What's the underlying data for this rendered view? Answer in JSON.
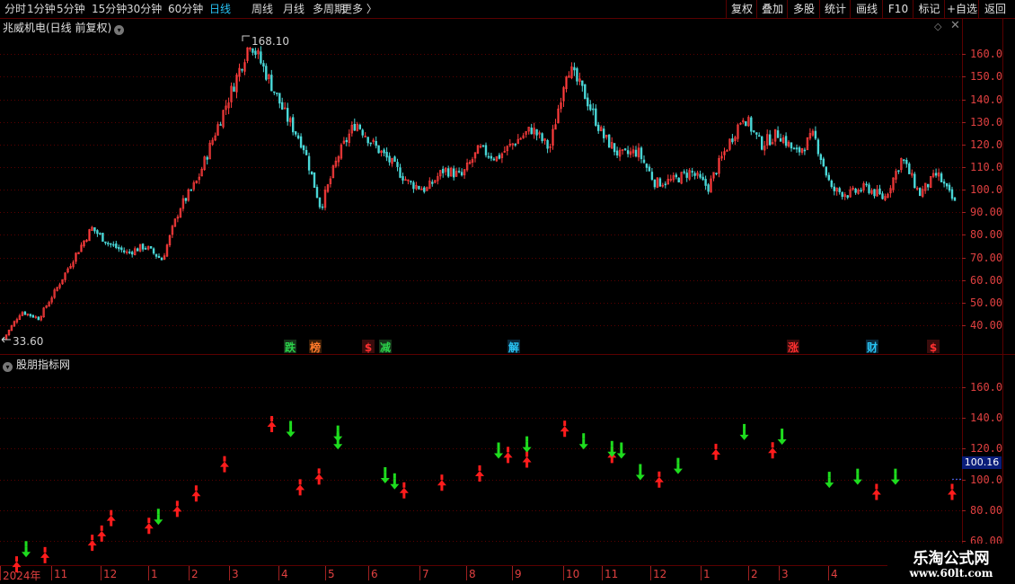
{
  "toolbar": {
    "periods": [
      {
        "label": "分时",
        "active": false
      },
      {
        "label": "1分钟",
        "active": false
      },
      {
        "label": "5分钟",
        "active": false
      },
      {
        "label": "15分钟",
        "active": false
      },
      {
        "label": "30分钟",
        "active": false
      },
      {
        "label": "60分钟",
        "active": false
      },
      {
        "label": "日线",
        "active": true
      },
      {
        "label": "周线",
        "active": false
      },
      {
        "label": "月线",
        "active": false
      },
      {
        "label": "多周期",
        "active": false
      },
      {
        "label": "更多 〉",
        "active": false
      }
    ],
    "buttons": [
      "复权",
      "叠加",
      "多股",
      "统计",
      "画线",
      "F10",
      "标记",
      "+自选",
      "返回"
    ]
  },
  "main_pane": {
    "title": "兆威机电(日线 前复权)",
    "max_label": "168.10",
    "min_label": "33.60",
    "y_ticks": [
      "160.0",
      "150.0",
      "140.0",
      "130.0",
      "120.0",
      "110.0",
      "100.0",
      "90.00",
      "80.00",
      "70.00",
      "60.00",
      "50.00",
      "40.00"
    ],
    "markers": [
      {
        "text": "跌",
        "color": "#2bd24a",
        "bg": "#16341a"
      },
      {
        "text": "榜",
        "color": "#ff7a2a",
        "bg": "#3a1e08"
      },
      {
        "text": "$",
        "color": "#ff3030",
        "bg": "#3a0c0c"
      },
      {
        "text": "减",
        "color": "#2bd24a",
        "bg": "#16341a"
      },
      {
        "text": "解",
        "color": "#28c4f4",
        "bg": "#0a2a3c"
      },
      {
        "text": "涨",
        "color": "#ff3030",
        "bg": "#3a0c0c"
      },
      {
        "text": "财",
        "color": "#28c4f4",
        "bg": "#0a2a3c"
      },
      {
        "text": "$",
        "color": "#ff3030",
        "bg": "#3a0c0c"
      }
    ]
  },
  "indicator_pane": {
    "title": "股朋指标网",
    "y_ticks": [
      "160.0",
      "140.0",
      "120.0",
      "100.0",
      "80.00",
      "60.00"
    ],
    "current_value": "100.16"
  },
  "x_axis": {
    "labels": [
      "2024年",
      "11",
      "12",
      "1",
      "2",
      "3",
      "4",
      "5",
      "6",
      "7",
      "8",
      "9",
      "10",
      "11",
      "12",
      "1",
      "2",
      "3",
      "4"
    ]
  },
  "watermark": {
    "line1": "乐淘公式网",
    "line2": "www.60lt.com"
  },
  "colors": {
    "up": "#ff3c3c",
    "down": "#4ad8d8",
    "grid": "#5a0000",
    "axis_text": "#e04040",
    "active": "#27c3f5",
    "buy_arrow": "#ff1c1c",
    "sell_arrow": "#1edc1e"
  },
  "chart_data": {
    "type": "candlestick",
    "title": "兆威机电(日线 前复权)",
    "period": "日线",
    "adjust": "前复权",
    "ylim": [
      33.6,
      168.1
    ],
    "max_marked": 168.1,
    "min_marked": 33.6,
    "y_ticks": [
      160,
      150,
      140,
      130,
      120,
      110,
      100,
      90,
      80,
      70,
      60,
      50,
      40
    ],
    "approx_close_path": [
      {
        "date": "2024-10",
        "close": 34
      },
      {
        "date": "2024-10",
        "close": 46
      },
      {
        "date": "2024-11",
        "close": 43
      },
      {
        "date": "2024-11",
        "close": 56
      },
      {
        "date": "2024-11",
        "close": 70
      },
      {
        "date": "2024-12",
        "close": 83
      },
      {
        "date": "2024-12",
        "close": 76
      },
      {
        "date": "2024-12",
        "close": 72
      },
      {
        "date": "2025-01",
        "close": 75
      },
      {
        "date": "2025-01",
        "close": 69
      },
      {
        "date": "2025-01",
        "close": 92
      },
      {
        "date": "2025-02",
        "close": 104
      },
      {
        "date": "2025-02",
        "close": 125
      },
      {
        "date": "2025-02",
        "close": 145
      },
      {
        "date": "2025-03",
        "close": 166
      },
      {
        "date": "2025-03",
        "close": 150
      },
      {
        "date": "2025-03",
        "close": 133
      },
      {
        "date": "2025-04",
        "close": 120
      },
      {
        "date": "2025-04",
        "close": 92
      },
      {
        "date": "2025-04",
        "close": 115
      },
      {
        "date": "2025-05",
        "close": 130
      },
      {
        "date": "2025-05",
        "close": 120
      },
      {
        "date": "2025-05",
        "close": 112
      },
      {
        "date": "2025-06",
        "close": 103
      },
      {
        "date": "2025-06",
        "close": 100
      },
      {
        "date": "2025-07",
        "close": 109
      },
      {
        "date": "2025-07",
        "close": 106
      },
      {
        "date": "2025-07",
        "close": 118
      },
      {
        "date": "2025-08",
        "close": 114
      },
      {
        "date": "2025-08",
        "close": 121
      },
      {
        "date": "2025-08",
        "close": 127
      },
      {
        "date": "2025-09",
        "close": 118
      },
      {
        "date": "2025-09",
        "close": 155
      },
      {
        "date": "2025-09",
        "close": 142
      },
      {
        "date": "2025-10",
        "close": 124
      },
      {
        "date": "2025-10",
        "close": 115
      },
      {
        "date": "2025-11",
        "close": 117
      },
      {
        "date": "2025-11",
        "close": 103
      },
      {
        "date": "2025-11",
        "close": 104
      },
      {
        "date": "2025-12",
        "close": 108
      },
      {
        "date": "2025-12",
        "close": 101
      },
      {
        "date": "2025-12",
        "close": 118
      },
      {
        "date": "2026-01",
        "close": 133
      },
      {
        "date": "2026-01",
        "close": 120
      },
      {
        "date": "2026-02",
        "close": 125
      },
      {
        "date": "2026-02",
        "close": 116
      },
      {
        "date": "2026-03",
        "close": 124
      },
      {
        "date": "2026-03",
        "close": 100
      },
      {
        "date": "2026-03",
        "close": 98
      },
      {
        "date": "2026-04",
        "close": 101
      },
      {
        "date": "2026-04",
        "close": 96
      },
      {
        "date": "2026-04",
        "close": 114
      },
      {
        "date": "2026-05",
        "close": 98
      },
      {
        "date": "2026-05",
        "close": 107
      },
      {
        "date": "2026-05",
        "close": 94
      }
    ],
    "indicator": {
      "name": "股朋指标网",
      "ylim": [
        45,
        175
      ],
      "y_ticks": [
        160,
        140,
        120,
        100,
        80,
        60
      ],
      "current": 100.16,
      "signals": [
        {
          "t": 0.01,
          "v": 42,
          "dir": "up"
        },
        {
          "t": 0.02,
          "v": 53,
          "dir": "down"
        },
        {
          "t": 0.04,
          "v": 48,
          "dir": "up"
        },
        {
          "t": 0.09,
          "v": 56,
          "dir": "up"
        },
        {
          "t": 0.1,
          "v": 62,
          "dir": "up"
        },
        {
          "t": 0.11,
          "v": 72,
          "dir": "up"
        },
        {
          "t": 0.15,
          "v": 67,
          "dir": "up"
        },
        {
          "t": 0.16,
          "v": 74,
          "dir": "down"
        },
        {
          "t": 0.18,
          "v": 78,
          "dir": "up"
        },
        {
          "t": 0.2,
          "v": 88,
          "dir": "up"
        },
        {
          "t": 0.23,
          "v": 107,
          "dir": "up"
        },
        {
          "t": 0.28,
          "v": 133,
          "dir": "up"
        },
        {
          "t": 0.3,
          "v": 131,
          "dir": "down"
        },
        {
          "t": 0.31,
          "v": 92,
          "dir": "up"
        },
        {
          "t": 0.33,
          "v": 99,
          "dir": "up"
        },
        {
          "t": 0.35,
          "v": 128,
          "dir": "down"
        },
        {
          "t": 0.35,
          "v": 123,
          "dir": "down"
        },
        {
          "t": 0.4,
          "v": 101,
          "dir": "down"
        },
        {
          "t": 0.41,
          "v": 97,
          "dir": "down"
        },
        {
          "t": 0.42,
          "v": 90,
          "dir": "up"
        },
        {
          "t": 0.46,
          "v": 95,
          "dir": "up"
        },
        {
          "t": 0.5,
          "v": 101,
          "dir": "up"
        },
        {
          "t": 0.52,
          "v": 117,
          "dir": "down"
        },
        {
          "t": 0.53,
          "v": 113,
          "dir": "up"
        },
        {
          "t": 0.55,
          "v": 110,
          "dir": "up"
        },
        {
          "t": 0.55,
          "v": 121,
          "dir": "down"
        },
        {
          "t": 0.59,
          "v": 130,
          "dir": "up"
        },
        {
          "t": 0.61,
          "v": 123,
          "dir": "down"
        },
        {
          "t": 0.64,
          "v": 113,
          "dir": "up"
        },
        {
          "t": 0.64,
          "v": 118,
          "dir": "down"
        },
        {
          "t": 0.65,
          "v": 117,
          "dir": "down"
        },
        {
          "t": 0.67,
          "v": 103,
          "dir": "down"
        },
        {
          "t": 0.69,
          "v": 97,
          "dir": "up"
        },
        {
          "t": 0.71,
          "v": 107,
          "dir": "down"
        },
        {
          "t": 0.75,
          "v": 115,
          "dir": "up"
        },
        {
          "t": 0.78,
          "v": 129,
          "dir": "down"
        },
        {
          "t": 0.81,
          "v": 116,
          "dir": "up"
        },
        {
          "t": 0.82,
          "v": 126,
          "dir": "down"
        },
        {
          "t": 0.87,
          "v": 98,
          "dir": "down"
        },
        {
          "t": 0.9,
          "v": 100,
          "dir": "down"
        },
        {
          "t": 0.92,
          "v": 89,
          "dir": "up"
        },
        {
          "t": 0.94,
          "v": 100,
          "dir": "down"
        },
        {
          "t": 1.0,
          "v": 89,
          "dir": "up"
        }
      ]
    }
  }
}
